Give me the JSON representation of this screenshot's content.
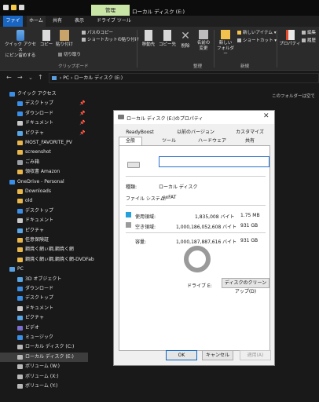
{
  "window": {
    "manage_tab": "管理",
    "title": "ローカル ディスク (E:)",
    "tab_icon_colors": [
      "#e2e2e2",
      "#f7c948",
      "#d9d9d9"
    ]
  },
  "ribbon_tabs": [
    "ファイル",
    "ホーム",
    "共有",
    "表示",
    "ドライブ ツール"
  ],
  "ribbon": {
    "pin_label_1": "クイック アクセス",
    "pin_label_2": "にピン留めする",
    "copy": "コピー",
    "paste": "貼り付け",
    "path_copy": "パスのコピー",
    "shortcut_paste": "ショートカットの貼り付け",
    "cut": "切り取り",
    "move_to_1": "移動先",
    "copy_to_1": "コピー先",
    "delete": "削除",
    "rename_1": "名前の",
    "rename_2": "変更",
    "new_folder_1": "新しい",
    "new_folder_2": "フォルダー",
    "new_item": "新しいアイテム",
    "shortcut": "ショートカット",
    "properties": "プロパティ",
    "edit": "編集",
    "history": "履歴",
    "open": "開く",
    "group_clipboard": "クリップボード",
    "group_organize": "整理",
    "group_new": "新規"
  },
  "address": {
    "back": "←",
    "forward": "→",
    "dropdown": "⌄",
    "up": "↑",
    "path": "›  PC  ›  ローカル ディスク (E:)"
  },
  "empty_folder_note": "このフォルダーは空です。",
  "sidebar": [
    {
      "label": "クイック アクセス",
      "color": "#3a8ee6",
      "indent": 12,
      "pin": ""
    },
    {
      "label": "デスクトップ",
      "color": "#3a8ee6",
      "indent": 22,
      "pin": "📌"
    },
    {
      "label": "ダウンロード",
      "color": "#3a8ee6",
      "indent": 22,
      "pin": "📌"
    },
    {
      "label": "ドキュメント",
      "color": "#c8c8c8",
      "indent": 22,
      "pin": "📌"
    },
    {
      "label": "ピクチャ",
      "color": "#58a6e6",
      "indent": 22,
      "pin": "📌"
    },
    {
      "label": "MOST_FAVORITE_PV",
      "color": "#e8b64a",
      "indent": 22,
      "pin": ""
    },
    {
      "label": "screenshot",
      "color": "#e8b64a",
      "indent": 22,
      "pin": ""
    },
    {
      "label": "ごみ箱",
      "color": "#9aa0a6",
      "indent": 22,
      "pin": ""
    },
    {
      "label": "領収書 Amazon",
      "color": "#e8b64a",
      "indent": 22,
      "pin": ""
    },
    {
      "label": "OneDrive - Personal",
      "color": "#3a8ee6",
      "indent": 12,
      "pin": ""
    },
    {
      "label": "Downloads",
      "color": "#e8b64a",
      "indent": 22,
      "pin": ""
    },
    {
      "label": "old",
      "color": "#e8b64a",
      "indent": 22,
      "pin": ""
    },
    {
      "label": "デスクトップ",
      "color": "#3a8ee6",
      "indent": 22,
      "pin": ""
    },
    {
      "label": "ドキュメント",
      "color": "#c8c8c8",
      "indent": 22,
      "pin": ""
    },
    {
      "label": "ピクチャ",
      "color": "#58a6e6",
      "indent": 22,
      "pin": ""
    },
    {
      "label": "任意保険証",
      "color": "#e8b64a",
      "indent": 22,
      "pin": ""
    },
    {
      "label": "鋼焼く網ぃ鋼,鋼焼く網",
      "color": "#e8b64a",
      "indent": 22,
      "pin": ""
    },
    {
      "label": "鋼焼く網ぃ鋼,鋼焼く網-DVDFab",
      "color": "#e8b64a",
      "indent": 22,
      "pin": ""
    },
    {
      "label": "PC",
      "color": "#5aa0e0",
      "indent": 12,
      "pin": ""
    },
    {
      "label": "3D オブジェクト",
      "color": "#58a6e6",
      "indent": 22,
      "pin": ""
    },
    {
      "label": "ダウンロード",
      "color": "#3a8ee6",
      "indent": 22,
      "pin": ""
    },
    {
      "label": "デスクトップ",
      "color": "#3a8ee6",
      "indent": 22,
      "pin": ""
    },
    {
      "label": "ドキュメント",
      "color": "#c8c8c8",
      "indent": 22,
      "pin": ""
    },
    {
      "label": "ピクチャ",
      "color": "#58a6e6",
      "indent": 22,
      "pin": ""
    },
    {
      "label": "ビデオ",
      "color": "#7a6fd0",
      "indent": 22,
      "pin": ""
    },
    {
      "label": "ミュージック",
      "color": "#3a8ee6",
      "indent": 22,
      "pin": ""
    },
    {
      "label": "ローカル ディスク (C:)",
      "color": "#b8b8b8",
      "indent": 22,
      "pin": ""
    },
    {
      "label": "ローカル ディスク (E:)",
      "color": "#b8b8b8",
      "indent": 22,
      "pin": "",
      "selected": true
    },
    {
      "label": "ボリューム (W:)",
      "color": "#b8b8b8",
      "indent": 22,
      "pin": ""
    },
    {
      "label": "ボリューム (X:)",
      "color": "#b8b8b8",
      "indent": 22,
      "pin": ""
    },
    {
      "label": "ボリューム (Y:)",
      "color": "#b8b8b8",
      "indent": 22,
      "pin": ""
    }
  ],
  "dialog": {
    "title": "ローカル ディスク (E:)のプロパティ",
    "close": "✕",
    "tabs_row1": [
      "ReadyBoost",
      "以前のバージョン",
      "カスタマイズ"
    ],
    "tabs_row2": [
      "全般",
      "ツール",
      "ハードウェア",
      "共有"
    ],
    "name_value": "",
    "type_label": "種類:",
    "type_value": "ローカル ディスク",
    "fs_label": "ファイル システム:",
    "fs_value": "exFAT",
    "used_label": "使用領域:",
    "used_bytes": "1,835,008 バイト",
    "used_size": "1.75 MB",
    "used_color": "#26a0da",
    "free_label": "空き領域:",
    "free_bytes": "1,000,186,052,608 バイト",
    "free_size": "931 GB",
    "free_color": "#9a9a9a",
    "cap_label": "容量:",
    "cap_bytes": "1,000,187,887,616 バイト",
    "cap_size": "931 GB",
    "drive_label": "ドライブ E:",
    "cleanup_button": "ディスクのクリーンアップ(D)",
    "ok": "OK",
    "cancel": "キャンセル",
    "apply": "適用(A)"
  }
}
